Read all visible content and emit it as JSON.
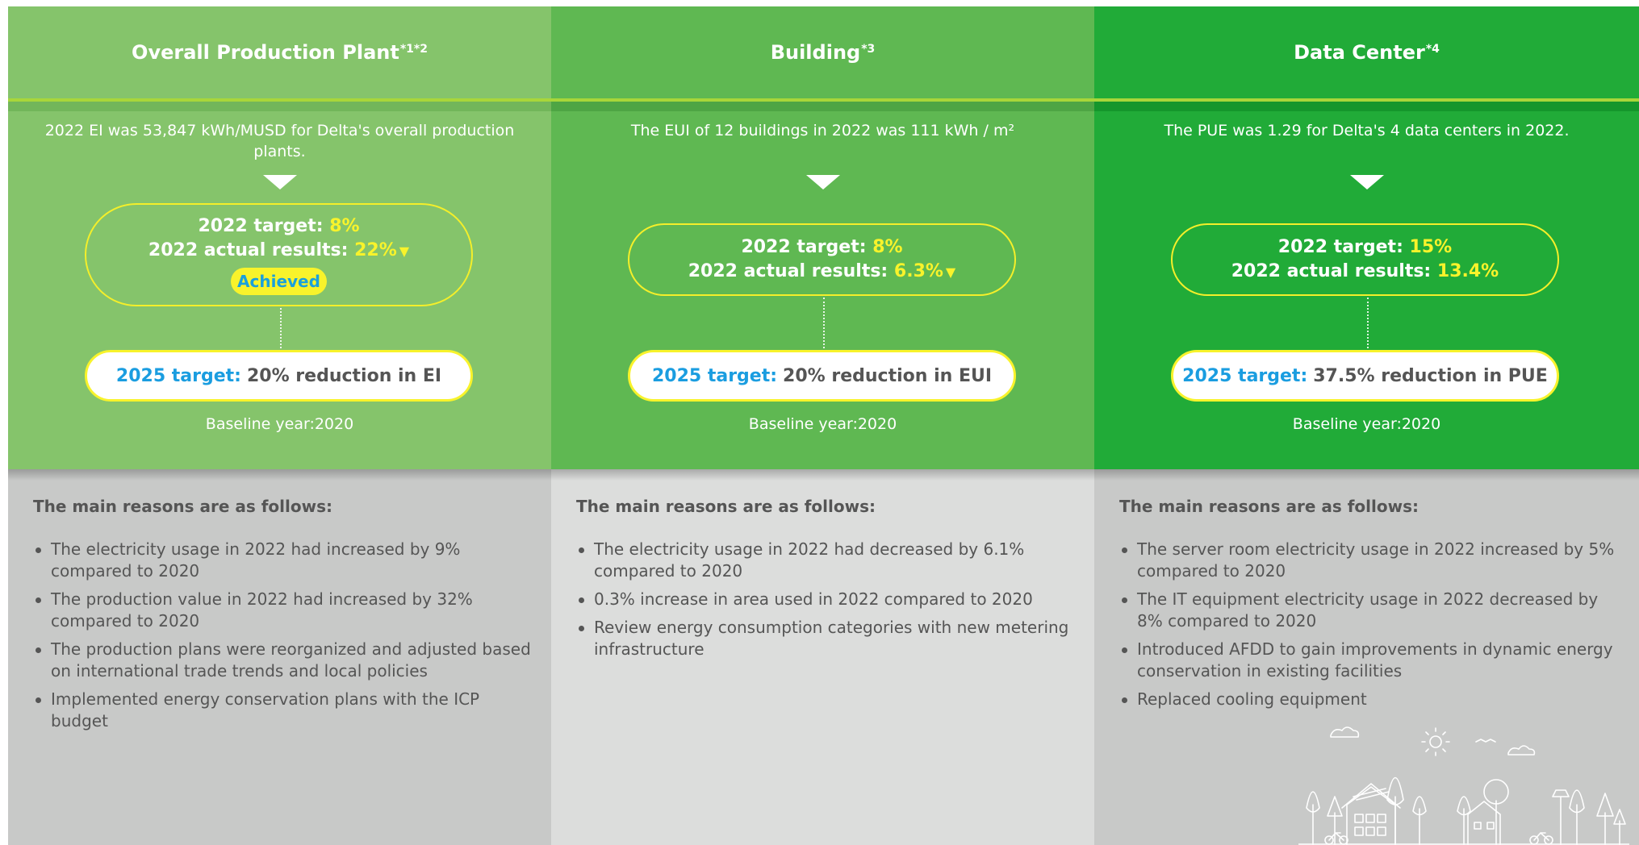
{
  "columns": [
    {
      "title": "Overall Production Plant",
      "title_sup": "*1*2",
      "description": "2022 EI was 53,847 kWh/MUSD for Delta's overall production plants.",
      "target_label": "2022 target:",
      "target_value": "8%",
      "actual_label": "2022 actual results:",
      "actual_value": "22%",
      "trend_icon": "down-triangle-icon",
      "badge": "Achieved",
      "goal_label": "2025 target:",
      "goal_text": "20% reduction in EI",
      "baseline": "Baseline year:2020",
      "reasons_title": "The main reasons are as follows:",
      "reasons": [
        "The electricity usage in 2022 had increased by 9% compared to 2020",
        "The production value in 2022 had increased by 32% compared to 2020",
        "The production plans were reorganized and adjusted based on international trade trends and local policies",
        "Implemented energy conservation plans with the ICP budget"
      ]
    },
    {
      "title": "Building",
      "title_sup": "*3",
      "description": "The EUI of 12 buildings in 2022 was 111 kWh / m²",
      "target_label": "2022 target:",
      "target_value": "8%",
      "actual_label": "2022 actual results:",
      "actual_value": "6.3%",
      "trend_icon": "down-triangle-icon",
      "goal_label": "2025 target:",
      "goal_text": "20% reduction in EUI",
      "baseline": "Baseline year:2020",
      "reasons_title": "The main reasons are as follows:",
      "reasons": [
        "The electricity usage in 2022 had decreased by 6.1% compared to 2020",
        "0.3% increase in area used in 2022 compared to 2020",
        "Review energy consumption categories with new metering infrastructure"
      ]
    },
    {
      "title": "Data Center",
      "title_sup": "*4",
      "description": "The PUE was 1.29 for Delta's 4 data centers in 2022.",
      "target_label": "2022 target:",
      "target_value": "15%",
      "actual_label": "2022 actual results:",
      "actual_value": "13.4%",
      "goal_label": "2025 target:",
      "goal_text": "37.5% reduction in PUE",
      "baseline": "Baseline year:2020",
      "reasons_title": "The main reasons are as follows:",
      "reasons": [
        "The server room electricity usage in 2022 increased by 5% compared to 2020",
        "The IT equipment electricity usage in 2022 decreased by 8% compared to 2020",
        "Introduced AFDD to gain improvements in dynamic energy conservation in existing facilities",
        "Replaced cooling equipment"
      ],
      "illustration_icon": "city-illustration-icon"
    }
  ],
  "colors": {
    "production_green": "#85c46b",
    "building_green": "#5fb852",
    "datacenter_green": "#21ab38",
    "highlight_yellow": "#f8f32b",
    "target_blue": "#1a9de0",
    "text_gray": "#555555"
  }
}
